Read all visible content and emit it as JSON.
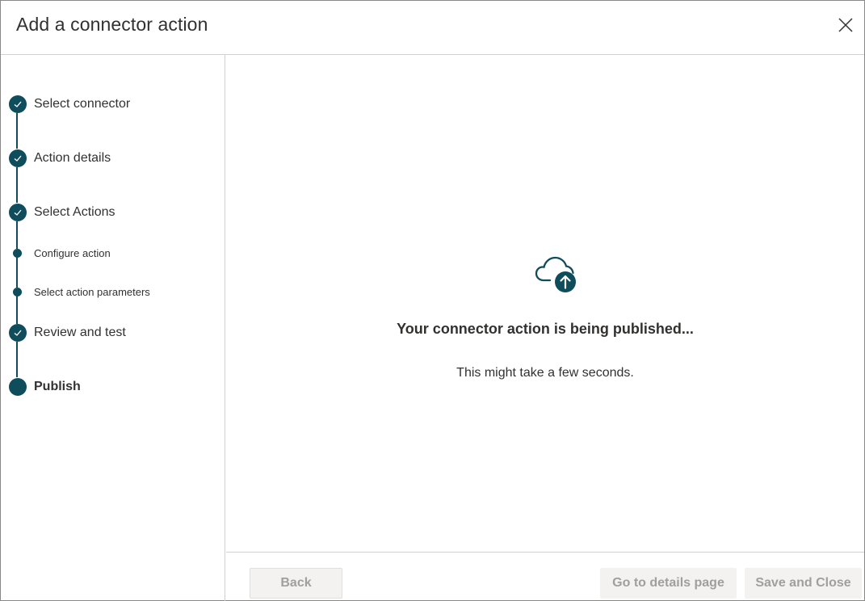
{
  "dialog": {
    "title": "Add a connector action"
  },
  "colors": {
    "accent": "#0f4c5c",
    "border": "#d2d0ce",
    "disabled_text": "#a19f9d",
    "disabled_bg": "#f3f2f1"
  },
  "steps": [
    {
      "label": "Select connector",
      "state": "completed",
      "icon": "checkmark-icon"
    },
    {
      "label": "Action details",
      "state": "completed",
      "icon": "checkmark-icon"
    },
    {
      "label": "Select Actions",
      "state": "completed",
      "icon": "checkmark-icon"
    },
    {
      "label": "Configure action",
      "state": "completed-substep"
    },
    {
      "label": "Select action parameters",
      "state": "completed-substep"
    },
    {
      "label": "Review and test",
      "state": "completed",
      "icon": "checkmark-icon"
    },
    {
      "label": "Publish",
      "state": "current"
    }
  ],
  "main": {
    "icon": "cloud-upload-icon",
    "heading": "Your connector action is being published...",
    "subtext": "This might take a few seconds."
  },
  "footer": {
    "back_label": "Back",
    "details_label": "Go to details page",
    "save_close_label": "Save and Close"
  }
}
